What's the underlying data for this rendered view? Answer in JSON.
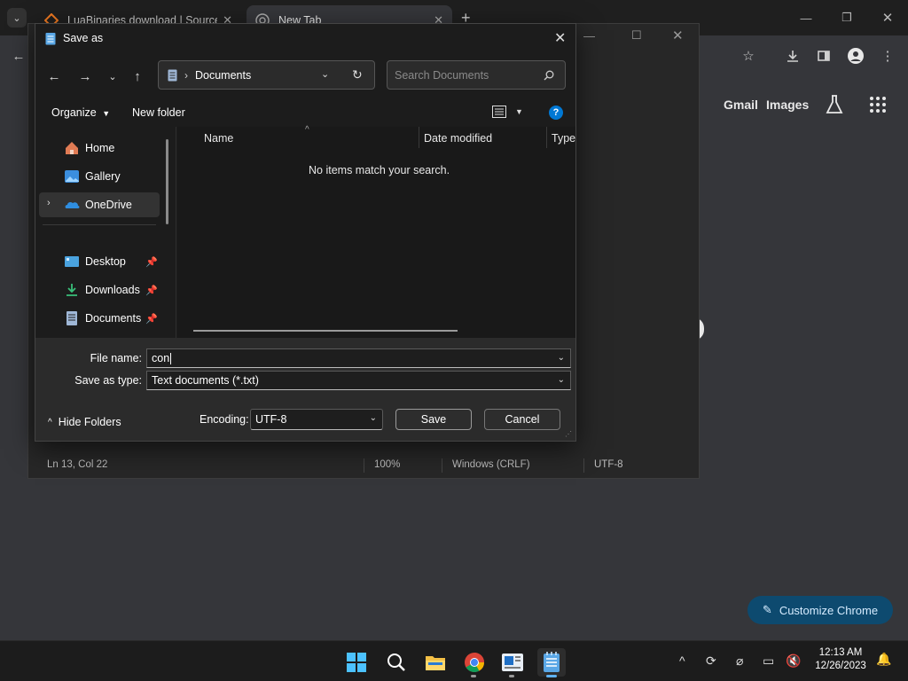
{
  "chrome": {
    "tabs": [
      {
        "title": "LuaBinaries download | SourceF"
      },
      {
        "title": "New Tab"
      }
    ],
    "ntp_links": {
      "gmail": "Gmail",
      "images": "Images"
    },
    "customize_label": "Customize Chrome"
  },
  "notepad": {
    "status": {
      "position": "Ln 13, Col 22",
      "zoom": "100%",
      "line_ending": "Windows (CRLF)",
      "encoding": "UTF-8"
    }
  },
  "dialog": {
    "title": "Save as",
    "breadcrumb": "Documents",
    "search_placeholder": "Search Documents",
    "organize_label": "Organize",
    "new_folder_label": "New folder",
    "nav_items": [
      {
        "label": "Home",
        "icon": "home-icon"
      },
      {
        "label": "Gallery",
        "icon": "gallery-icon"
      },
      {
        "label": "OneDrive",
        "icon": "onedrive-icon"
      },
      {
        "label": "Desktop",
        "icon": "desktop-folder-icon"
      },
      {
        "label": "Downloads",
        "icon": "downloads-icon"
      },
      {
        "label": "Documents",
        "icon": "documents-icon"
      }
    ],
    "columns": [
      "Name",
      "Date modified",
      "Type"
    ],
    "empty_message": "No items match your search.",
    "file_name_label": "File name:",
    "file_name_value": "con",
    "save_type_label": "Save as type:",
    "save_type_value": "Text documents (*.txt)",
    "hide_folders_label": "Hide Folders",
    "encoding_label": "Encoding:",
    "encoding_value": "UTF-8",
    "save_label": "Save",
    "cancel_label": "Cancel"
  },
  "taskbar": {
    "time": "12:13 AM",
    "date": "12/26/2023",
    "apps": [
      "start-icon",
      "search-icon",
      "file-explorer-icon",
      "chrome-icon",
      "app-icon",
      "notepad-icon"
    ]
  },
  "colors": {
    "accent": "#0078d4",
    "dialog_bg": "#1c1c1c",
    "customize_bg": "#0d4a6f"
  }
}
